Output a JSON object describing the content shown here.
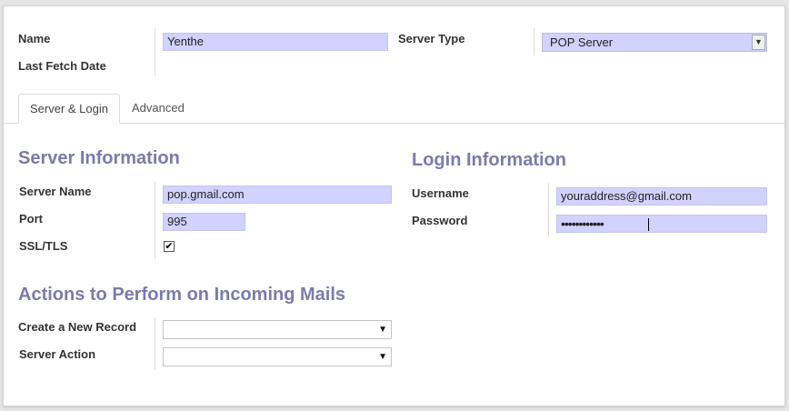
{
  "header": {
    "name_label": "Name",
    "name_value": "Yenthe",
    "last_fetch_label": "Last Fetch Date",
    "server_type_label": "Server Type",
    "server_type_value": "POP Server"
  },
  "tabs": [
    {
      "label": "Server & Login",
      "active": true
    },
    {
      "label": "Advanced",
      "active": false
    }
  ],
  "server_info": {
    "title": "Server Information",
    "server_name_label": "Server Name",
    "server_name_value": "pop.gmail.com",
    "port_label": "Port",
    "port_value": "995",
    "ssl_label": "SSL/TLS",
    "ssl_checked": true
  },
  "login_info": {
    "title": "Login Information",
    "username_label": "Username",
    "username_value": "youraddress@gmail.com",
    "password_label": "Password",
    "password_value": "••••••••••••"
  },
  "actions": {
    "title": "Actions to Perform on Incoming Mails",
    "create_record_label": "Create a New Record",
    "create_record_value": "",
    "server_action_label": "Server Action",
    "server_action_value": ""
  },
  "icons": {
    "dropdown_arrow": "▼",
    "check": "✔"
  },
  "colors": {
    "required_field_bg": "#d2d2ff",
    "section_title": "#7c7bad"
  }
}
